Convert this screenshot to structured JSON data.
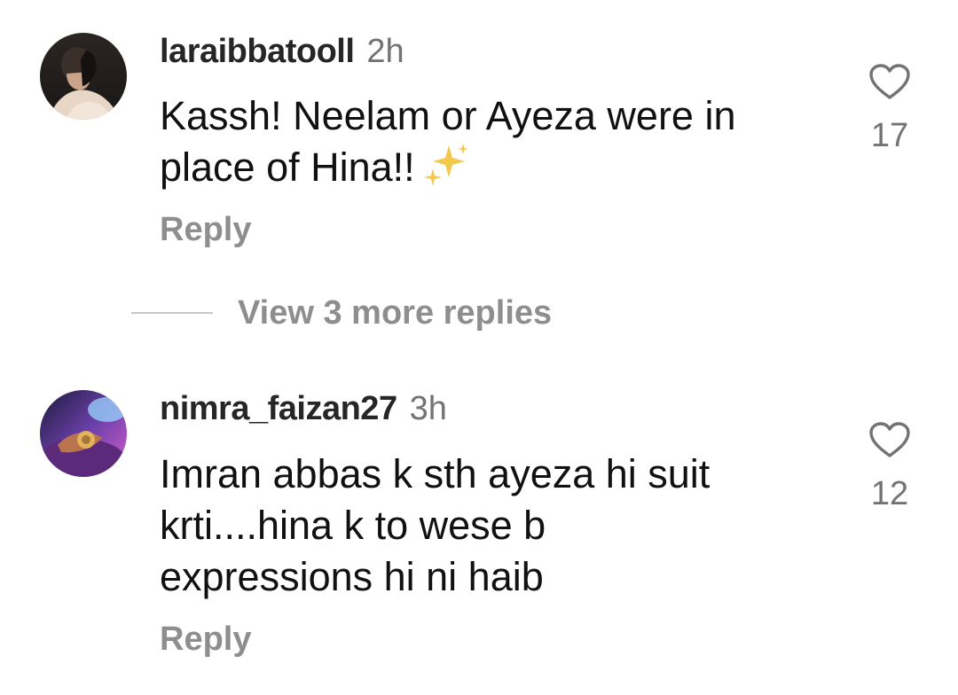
{
  "comments": [
    {
      "username": "laraibbatooll",
      "time": "2h",
      "text_lines": [
        "Kassh! Neelam or Ayeza were in",
        "place of Hina!!"
      ],
      "emoji": "sparkles",
      "likes": "17",
      "reply_label": "Reply",
      "avatar_icon": "profile-photo"
    },
    {
      "username": "nimra_faizan27",
      "time": "3h",
      "text_lines": [
        "Imran abbas k sth ayeza hi suit",
        "krti....hina k to wese b",
        "expressions hi ni haib"
      ],
      "likes": "12",
      "reply_label": "Reply",
      "avatar_icon": "profile-photo"
    }
  ],
  "view_more_replies": "View 3 more replies",
  "colors": {
    "text": "#111111",
    "username": "#262626",
    "muted": "#737373",
    "action": "#8e8e8e",
    "divider": "#c7c7c7",
    "sparkle": "#f2c94c"
  },
  "icons": {
    "like": "heart-outline-icon",
    "emoji": "sparkles-icon"
  }
}
